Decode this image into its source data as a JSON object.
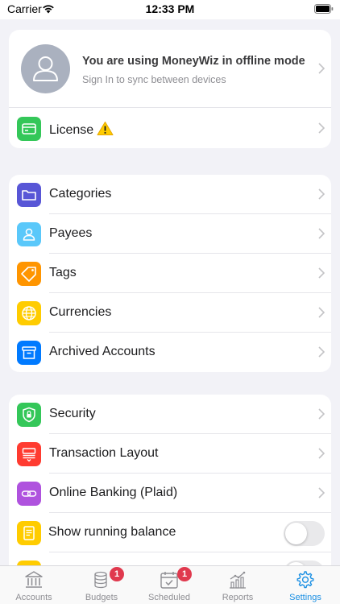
{
  "status_bar": {
    "carrier": "Carrier",
    "time": "12:33 PM"
  },
  "profile": {
    "title": "You are using MoneyWiz in offline mode",
    "subtitle": "Sign In to sync between devices"
  },
  "license": {
    "label": "License"
  },
  "lists": [
    {
      "label": "Categories",
      "icon": "folder-icon",
      "color": "#5856d6"
    },
    {
      "label": "Payees",
      "icon": "person-icon",
      "color": "#5ac8fa"
    },
    {
      "label": "Tags",
      "icon": "tag-icon",
      "color": "#ff9500"
    },
    {
      "label": "Currencies",
      "icon": "globe-icon",
      "color": "#ffcc00"
    },
    {
      "label": "Archived Accounts",
      "icon": "archive-box-icon",
      "color": "#007aff"
    }
  ],
  "settings": [
    {
      "label": "Security",
      "icon": "shield-icon",
      "color": "#34c759"
    },
    {
      "label": "Transaction Layout",
      "icon": "layout-icon",
      "color": "#ff3b30"
    },
    {
      "label": "Online Banking (Plaid)",
      "icon": "link-icon",
      "color": "#af52de"
    },
    {
      "label": "Show running balance",
      "icon": "document-icon",
      "color": "#ffcc00",
      "toggle_on": false
    }
  ],
  "tabs": [
    {
      "label": "Accounts",
      "icon": "bank-icon",
      "badge": ""
    },
    {
      "label": "Budgets",
      "icon": "coins-icon",
      "badge": "1"
    },
    {
      "label": "Scheduled",
      "icon": "calendar-icon",
      "badge": "1"
    },
    {
      "label": "Reports",
      "icon": "chart-icon",
      "badge": ""
    },
    {
      "label": "Settings",
      "icon": "gear-icon",
      "badge": "",
      "active": true
    }
  ],
  "colors": {
    "accent": "#1a8fe3",
    "badge": "#e0394e",
    "license_icon": "#34c759"
  }
}
